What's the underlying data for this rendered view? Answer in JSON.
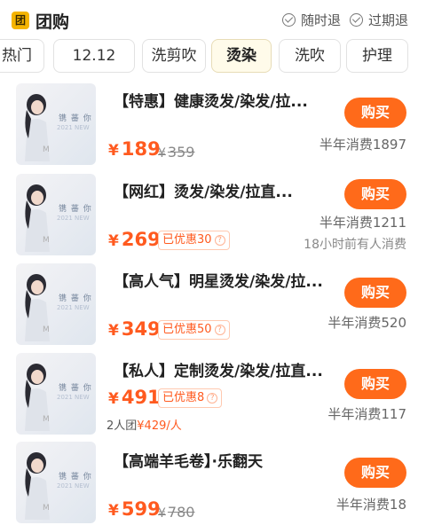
{
  "header": {
    "logo_text": "团",
    "title": "团购",
    "guarantee1": "随时退",
    "guarantee2": "过期退"
  },
  "tabs": [
    "热门",
    "12.12",
    "洗剪吹",
    "烫染",
    "洗吹",
    "护理"
  ],
  "active_tab": "烫染",
  "items": [
    {
      "name": "【特惠】健康烫发/染发/拉...",
      "currency": "¥",
      "price": "189",
      "original_price": "359",
      "sold": "半年消费1897",
      "buy_label": "购买"
    },
    {
      "name": "【网红】烫发/染发/拉直...",
      "currency": "¥",
      "price": "269",
      "discount": "已优惠30",
      "sold": "半年消费1211",
      "recent": "18小时前有人消费",
      "buy_label": "购买"
    },
    {
      "name": "【高人气】明星烫发/染发/拉...",
      "currency": "¥",
      "price": "349",
      "discount": "已优惠50",
      "sold": "半年消费520",
      "buy_label": "购买"
    },
    {
      "name": "【私人】定制烫发/染发/拉直...",
      "currency": "¥",
      "price": "491",
      "discount": "已优惠8",
      "group_label": "2人团",
      "group_price": "¥429/人",
      "sold": "半年消费117",
      "buy_label": "购买"
    },
    {
      "name": "【高端羊毛卷】·乐翻天",
      "currency": "¥",
      "price": "599",
      "original_price": "780",
      "sold": "半年消费18",
      "buy_label": "购买"
    }
  ],
  "thumbnail": {
    "poster_text": "镌 蕃 你 的 都",
    "poster_sub": "2021 NEW",
    "poster_mark": "M"
  },
  "colors": {
    "accent": "#ff6a1a",
    "price": "#ff5a1f",
    "tab_active_bg": "#fffbea",
    "logo": "#f5b400"
  }
}
